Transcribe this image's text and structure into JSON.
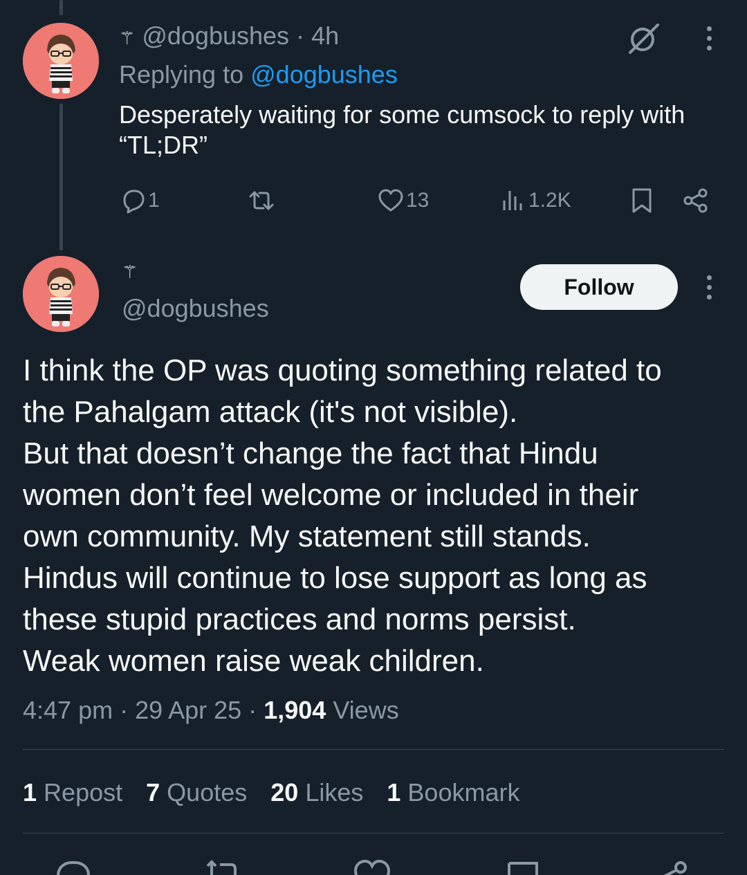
{
  "reply": {
    "mascot": "⚚",
    "handle": "@dogbushes",
    "separator": "·",
    "time": "4h",
    "replying_prefix": "Replying to",
    "replying_handle": "@dogbushes",
    "text": "Desperately waiting for some cumsock to reply with\n“TL;DR”",
    "actions": {
      "replies": "1",
      "reposts": "",
      "likes": "13",
      "views": "1.2K"
    },
    "icons": [
      "grok-icon",
      "more-icon",
      "reply-icon",
      "repost-icon",
      "like-icon",
      "views-icon",
      "bookmark-icon",
      "share-icon"
    ]
  },
  "main": {
    "mascot": "⚚",
    "handle": "@dogbushes",
    "follow_label": "Follow",
    "text": "I think the OP was quoting something related to\nthe Pahalgam attack (it's not visible).\nBut that doesn’t change the fact that Hindu\nwomen don’t feel welcome or included in their\nown community. My statement still stands.\nHindus will continue to lose support as long as\nthese stupid practices and norms persist.\nWeak women raise weak children.",
    "meta": {
      "time": "4:47 pm",
      "date": "29 Apr 25",
      "views_count": "1,904",
      "views_label": "Views"
    },
    "stats": {
      "reposts_count": "1",
      "reposts_label": "Repost",
      "quotes_count": "7",
      "quotes_label": "Quotes",
      "likes_count": "20",
      "likes_label": "Likes",
      "bookmarks_count": "1",
      "bookmarks_label": "Bookmark"
    }
  },
  "colors": {
    "background": "#15202b",
    "text": "#f7f9f9",
    "muted": "#8b98a5",
    "link": "#1d9bf0",
    "avatar_bg": "#ee7a73",
    "follow_bg": "#eff3f4"
  }
}
